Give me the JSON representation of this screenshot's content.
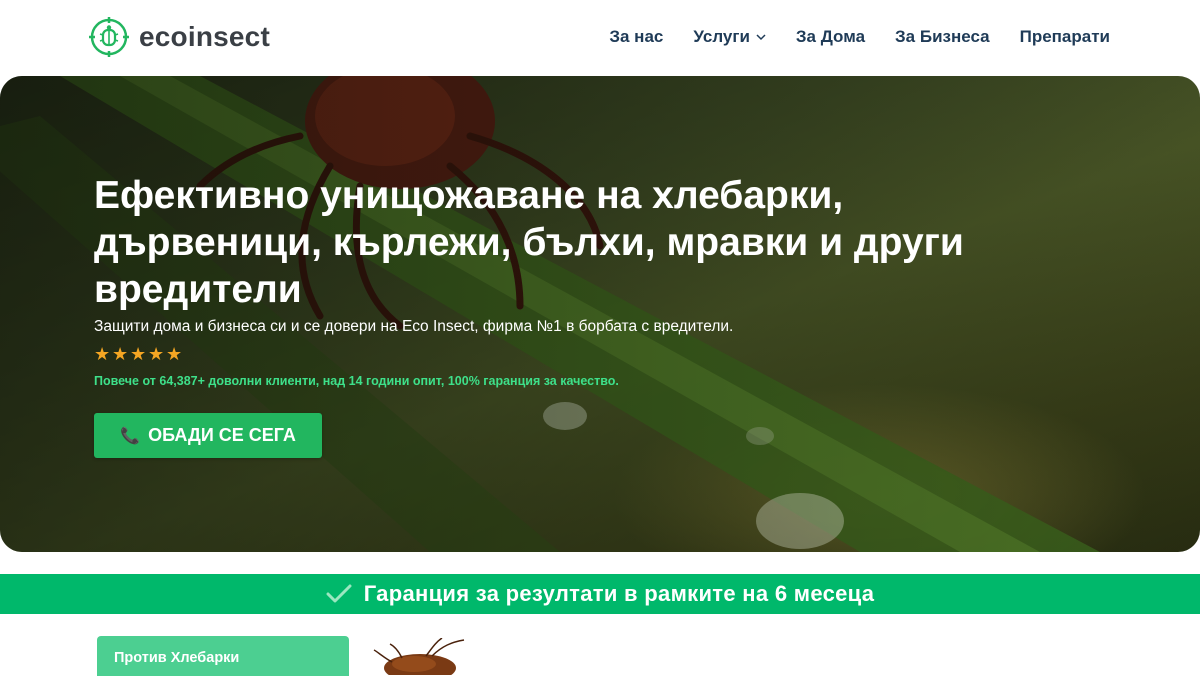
{
  "brand": {
    "name": "ecoinsect",
    "accent": "#22b65f"
  },
  "nav": {
    "items": [
      {
        "label": "За нас"
      },
      {
        "label": "Услуги",
        "icon": "chevron-down-icon"
      },
      {
        "label": "За Дома"
      },
      {
        "label": "За Бизнеса"
      },
      {
        "label": "Препарати"
      }
    ]
  },
  "hero": {
    "title": "Ефективно унищожаване на хлебарки, дървеници, кърлежи, бълхи, мравки и други вредители",
    "subtitle": "Защити дома и бизнеса си и се довери на Eco Insect, фирма №1 в борбата с вредители.",
    "rating": 5,
    "proof": "Повече от 64,387+ доволни клиенти, над 14 години опит, 100% гаранция за качество.",
    "cta_label": "ОБАДИ СЕ СЕГА",
    "cta_icon": "phone-icon"
  },
  "guarantee": {
    "text": "Гаранция за резултати в рамките на 6 месеца",
    "icon": "check-icon"
  },
  "services": {
    "first_tab": "Против Хлебарки",
    "image": "cockroach-image"
  }
}
